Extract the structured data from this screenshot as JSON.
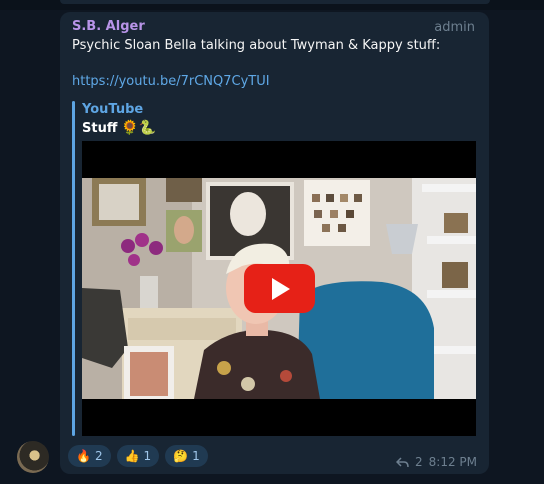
{
  "message": {
    "sender": "S.B. Alger",
    "role": "admin",
    "text": "Psychic Sloan Bella talking about Twyman & Kappy stuff:",
    "link": "https://youtu.be/7rCNQ7CyTUI",
    "time": "8:12 PM",
    "reply_count": "2",
    "sender_color": "#b894e8"
  },
  "preview": {
    "site": "YouTube",
    "title": "Stuff",
    "title_emojis": "🌻🐍",
    "play_icon": "play-icon",
    "accent": "#5ea5e3"
  },
  "reactions": [
    {
      "emoji": "🔥",
      "count": "2",
      "icon": "fire-icon"
    },
    {
      "emoji": "👍",
      "count": "1",
      "icon": "thumbs-up-icon"
    },
    {
      "emoji": "🤔",
      "count": "1",
      "icon": "thinking-face-icon"
    }
  ]
}
